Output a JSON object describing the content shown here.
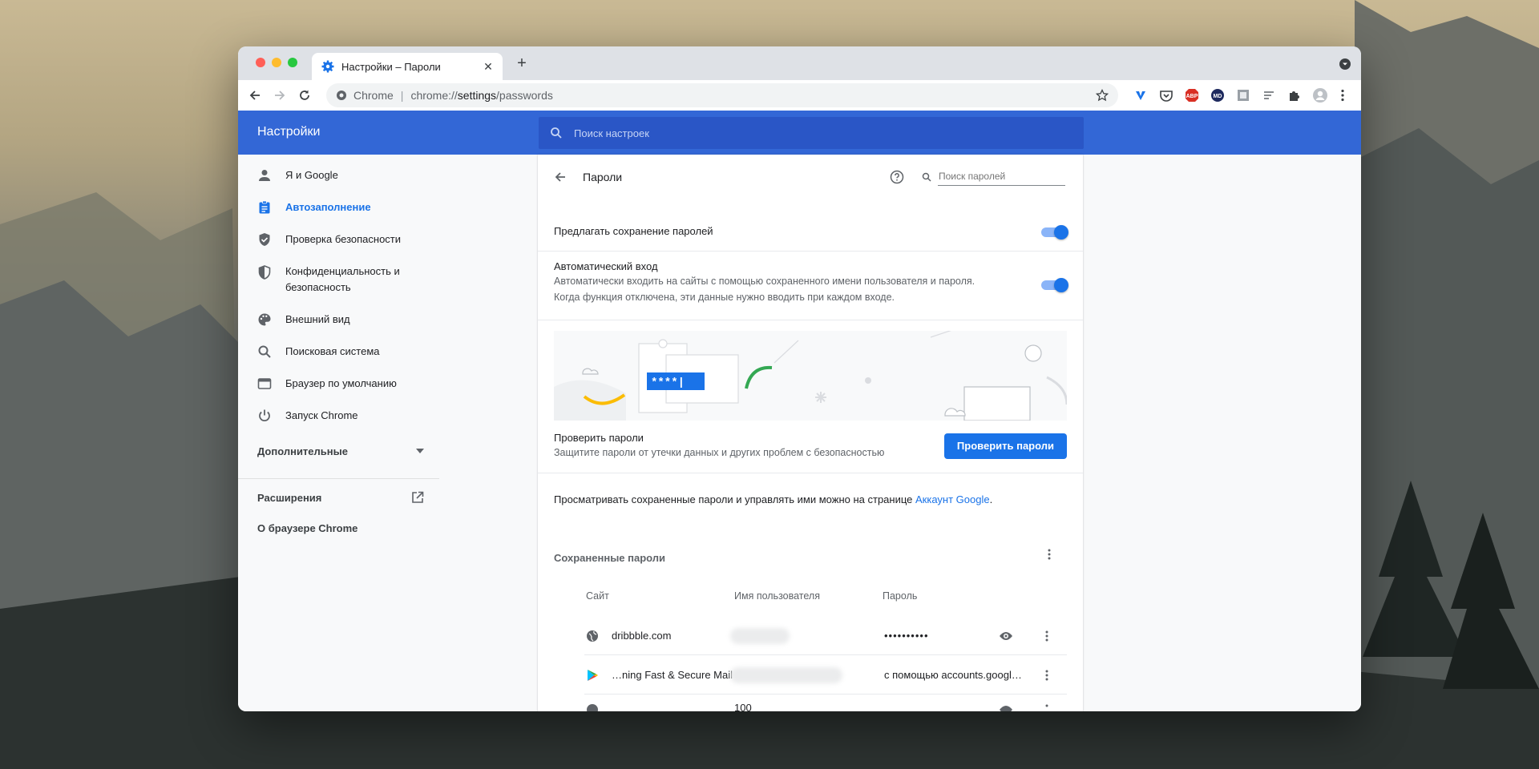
{
  "window": {
    "tab_title": "Настройки – Пароли",
    "url_site": "Chrome",
    "url_prefix": "chrome://",
    "url_host": "settings",
    "url_path": "/passwords"
  },
  "header": {
    "title": "Настройки",
    "search_placeholder": "Поиск настроек"
  },
  "sidebar": {
    "items": [
      {
        "label": "Я и Google",
        "icon": "person-icon"
      },
      {
        "label": "Автозаполнение",
        "icon": "clipboard-icon",
        "selected": true
      },
      {
        "label": "Проверка безопасности",
        "icon": "shield-check-icon"
      },
      {
        "label": "Конфиденциальность и безопасность",
        "icon": "shield-half-icon"
      },
      {
        "label": "Внешний вид",
        "icon": "palette-icon"
      },
      {
        "label": "Поисковая система",
        "icon": "search-icon"
      },
      {
        "label": "Браузер по умолчанию",
        "icon": "browser-icon"
      },
      {
        "label": "Запуск Chrome",
        "icon": "power-icon"
      }
    ],
    "advanced": "Дополнительные",
    "extensions": "Расширения",
    "about": "О браузере Chrome"
  },
  "passwords": {
    "title": "Пароли",
    "search_placeholder": "Поиск паролей",
    "offer_save": "Предлагать сохранение паролей",
    "offer_save_on": true,
    "autologin_title": "Автоматический вход",
    "autologin_desc1": "Автоматически входить на сайты с помощью сохраненного имени пользователя и пароля.",
    "autologin_desc2": "Когда функция отключена, эти данные нужно вводить при каждом входе.",
    "autologin_on": true,
    "illustration_text": "****|",
    "check_title": "Проверить пароли",
    "check_desc": "Защитите пароли от утечки данных и других проблем с безопасностью",
    "check_button": "Проверить пароли",
    "manage_text": "Просматривать сохраненные пароли и управлять ими можно на странице ",
    "manage_link": "Аккаунт Google",
    "manage_end": ".",
    "saved_title": "Сохраненные пароли",
    "columns": [
      "Сайт",
      "Имя пользователя",
      "Пароль"
    ],
    "rows": [
      {
        "site": "dribbble.com",
        "password": "••••••••••",
        "icon": "globe-icon"
      },
      {
        "site": "…ning Fast & Secure Mail",
        "password": "с помощью accounts.googl…",
        "icon": "play-store-icon"
      }
    ],
    "partial_user": "100"
  },
  "colors": {
    "accent": "#1a73e8",
    "header": "#3367d6"
  }
}
